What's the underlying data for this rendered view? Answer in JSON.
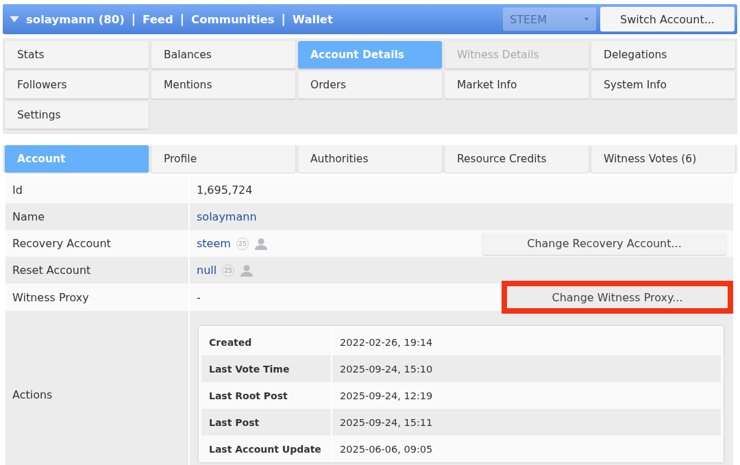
{
  "header": {
    "links": [
      {
        "label": "solaymann (80)",
        "kind": "account"
      },
      {
        "label": "Feed",
        "kind": "link",
        "separator": "|"
      },
      {
        "label": "Communities",
        "kind": "link",
        "separator": "|"
      },
      {
        "label": "Wallet",
        "kind": "link",
        "separator": "|"
      }
    ],
    "chain_select": {
      "value": "STEEM"
    },
    "switch_button": "Switch Account..."
  },
  "menu": [
    {
      "label": "Stats",
      "selected": false,
      "disabled": false
    },
    {
      "label": "Balances",
      "selected": false,
      "disabled": false
    },
    {
      "label": "Account Details",
      "selected": true,
      "disabled": false
    },
    {
      "label": "Witness Details",
      "selected": false,
      "disabled": true
    },
    {
      "label": "Delegations",
      "selected": false,
      "disabled": false
    },
    {
      "label": "Followers",
      "selected": false,
      "disabled": false
    },
    {
      "label": "Mentions",
      "selected": false,
      "disabled": false
    },
    {
      "label": "Orders",
      "selected": false,
      "disabled": false
    },
    {
      "label": "Market Info",
      "selected": false,
      "disabled": false
    },
    {
      "label": "System Info",
      "selected": false,
      "disabled": false
    },
    {
      "label": "Settings",
      "selected": false,
      "disabled": false
    }
  ],
  "tabs": [
    {
      "label": "Account",
      "selected": true
    },
    {
      "label": "Profile",
      "selected": false
    },
    {
      "label": "Authorities",
      "selected": false
    },
    {
      "label": "Resource Credits",
      "selected": false
    },
    {
      "label": "Witness Votes (6)",
      "selected": false
    }
  ],
  "rows": [
    {
      "label": "Id",
      "kind": "text",
      "value": "1,695,724"
    },
    {
      "label": "Name",
      "kind": "link",
      "value": "solaymann"
    },
    {
      "label": "Recovery Account",
      "kind": "account",
      "value": "steem",
      "badge": "25",
      "action": {
        "label": "Change Recovery Account...",
        "highlighted": false
      }
    },
    {
      "label": "Reset Account",
      "kind": "account",
      "value": "null",
      "badge": "25"
    },
    {
      "label": "Witness Proxy",
      "kind": "text",
      "value": "-",
      "action": {
        "label": "Change Witness Proxy...",
        "highlighted": true
      }
    },
    {
      "label": "Actions",
      "kind": "details",
      "details": [
        {
          "label": "Created",
          "value": "2022-02-26, 19:14"
        },
        {
          "label": "Last Vote Time",
          "value": "2025-09-24, 15:10"
        },
        {
          "label": "Last Root Post",
          "value": "2025-09-24, 12:19"
        },
        {
          "label": "Last Post",
          "value": "2025-09-24, 15:11"
        },
        {
          "label": "Last Account Update",
          "value": "2025-06-06, 09:05"
        }
      ]
    }
  ]
}
